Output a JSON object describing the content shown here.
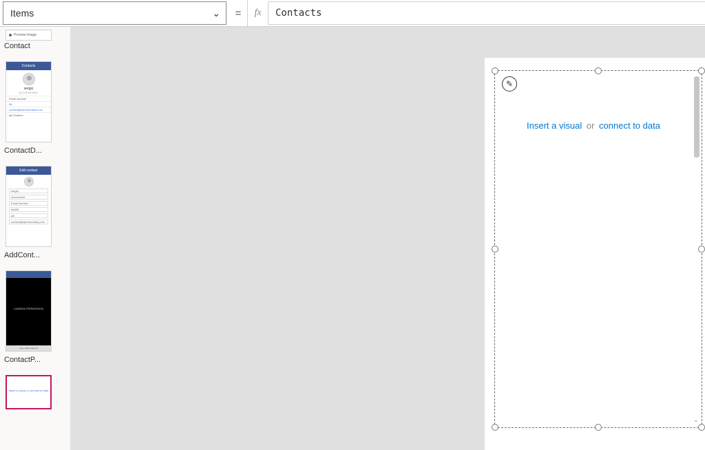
{
  "formulaBar": {
    "property": "Items",
    "equals": "=",
    "fxLabel": "fx",
    "value": "Contacts"
  },
  "screens": {
    "item0": {
      "label": "Contact"
    },
    "item1": {
      "label": "ContactD..."
    },
    "item2": {
      "label": "AddCont..."
    },
    "item3": {
      "label": "ContactP..."
    },
    "thumb1": {
      "header": "Contacts",
      "name": "sergio",
      "sub": "ACCOUNTANT",
      "rows": [
        "Email Number",
        "56",
        "contact@ephemeralhq.com",
        "job Position"
      ]
    },
    "thumb2": {
      "header": "Edit contact",
      "fields": [
        "sergio",
        "Accountant",
        "Email Number",
        "56555",
        "job",
        "contact@ephemeralhq.com"
      ]
    },
    "thumb3": {
      "text": "CAMERA PERMISSION",
      "bottom": "tap to allow camera"
    },
    "thumb4": {
      "text": "Insert a visual or connect to data"
    }
  },
  "canvas": {
    "placeholder": {
      "link1": "Insert a visual",
      "or": "or",
      "link2": "connect to data"
    },
    "pencilGlyph": "✎"
  }
}
